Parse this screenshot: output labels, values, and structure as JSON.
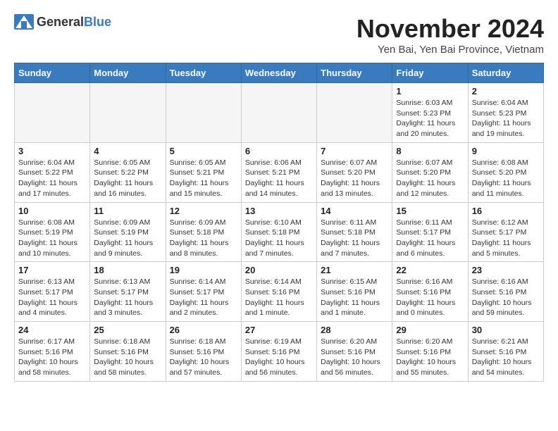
{
  "header": {
    "logo_general": "General",
    "logo_blue": "Blue",
    "month_title": "November 2024",
    "location": "Yen Bai, Yen Bai Province, Vietnam"
  },
  "weekdays": [
    "Sunday",
    "Monday",
    "Tuesday",
    "Wednesday",
    "Thursday",
    "Friday",
    "Saturday"
  ],
  "weeks": [
    [
      {
        "day": "",
        "info": ""
      },
      {
        "day": "",
        "info": ""
      },
      {
        "day": "",
        "info": ""
      },
      {
        "day": "",
        "info": ""
      },
      {
        "day": "",
        "info": ""
      },
      {
        "day": "1",
        "info": "Sunrise: 6:03 AM\nSunset: 5:23 PM\nDaylight: 11 hours and 20 minutes."
      },
      {
        "day": "2",
        "info": "Sunrise: 6:04 AM\nSunset: 5:23 PM\nDaylight: 11 hours and 19 minutes."
      }
    ],
    [
      {
        "day": "3",
        "info": "Sunrise: 6:04 AM\nSunset: 5:22 PM\nDaylight: 11 hours and 17 minutes."
      },
      {
        "day": "4",
        "info": "Sunrise: 6:05 AM\nSunset: 5:22 PM\nDaylight: 11 hours and 16 minutes."
      },
      {
        "day": "5",
        "info": "Sunrise: 6:05 AM\nSunset: 5:21 PM\nDaylight: 11 hours and 15 minutes."
      },
      {
        "day": "6",
        "info": "Sunrise: 6:06 AM\nSunset: 5:21 PM\nDaylight: 11 hours and 14 minutes."
      },
      {
        "day": "7",
        "info": "Sunrise: 6:07 AM\nSunset: 5:20 PM\nDaylight: 11 hours and 13 minutes."
      },
      {
        "day": "8",
        "info": "Sunrise: 6:07 AM\nSunset: 5:20 PM\nDaylight: 11 hours and 12 minutes."
      },
      {
        "day": "9",
        "info": "Sunrise: 6:08 AM\nSunset: 5:20 PM\nDaylight: 11 hours and 11 minutes."
      }
    ],
    [
      {
        "day": "10",
        "info": "Sunrise: 6:08 AM\nSunset: 5:19 PM\nDaylight: 11 hours and 10 minutes."
      },
      {
        "day": "11",
        "info": "Sunrise: 6:09 AM\nSunset: 5:19 PM\nDaylight: 11 hours and 9 minutes."
      },
      {
        "day": "12",
        "info": "Sunrise: 6:09 AM\nSunset: 5:18 PM\nDaylight: 11 hours and 8 minutes."
      },
      {
        "day": "13",
        "info": "Sunrise: 6:10 AM\nSunset: 5:18 PM\nDaylight: 11 hours and 7 minutes."
      },
      {
        "day": "14",
        "info": "Sunrise: 6:11 AM\nSunset: 5:18 PM\nDaylight: 11 hours and 7 minutes."
      },
      {
        "day": "15",
        "info": "Sunrise: 6:11 AM\nSunset: 5:17 PM\nDaylight: 11 hours and 6 minutes."
      },
      {
        "day": "16",
        "info": "Sunrise: 6:12 AM\nSunset: 5:17 PM\nDaylight: 11 hours and 5 minutes."
      }
    ],
    [
      {
        "day": "17",
        "info": "Sunrise: 6:13 AM\nSunset: 5:17 PM\nDaylight: 11 hours and 4 minutes."
      },
      {
        "day": "18",
        "info": "Sunrise: 6:13 AM\nSunset: 5:17 PM\nDaylight: 11 hours and 3 minutes."
      },
      {
        "day": "19",
        "info": "Sunrise: 6:14 AM\nSunset: 5:17 PM\nDaylight: 11 hours and 2 minutes."
      },
      {
        "day": "20",
        "info": "Sunrise: 6:14 AM\nSunset: 5:16 PM\nDaylight: 11 hours and 1 minute."
      },
      {
        "day": "21",
        "info": "Sunrise: 6:15 AM\nSunset: 5:16 PM\nDaylight: 11 hours and 1 minute."
      },
      {
        "day": "22",
        "info": "Sunrise: 6:16 AM\nSunset: 5:16 PM\nDaylight: 11 hours and 0 minutes."
      },
      {
        "day": "23",
        "info": "Sunrise: 6:16 AM\nSunset: 5:16 PM\nDaylight: 10 hours and 59 minutes."
      }
    ],
    [
      {
        "day": "24",
        "info": "Sunrise: 6:17 AM\nSunset: 5:16 PM\nDaylight: 10 hours and 58 minutes."
      },
      {
        "day": "25",
        "info": "Sunrise: 6:18 AM\nSunset: 5:16 PM\nDaylight: 10 hours and 58 minutes."
      },
      {
        "day": "26",
        "info": "Sunrise: 6:18 AM\nSunset: 5:16 PM\nDaylight: 10 hours and 57 minutes."
      },
      {
        "day": "27",
        "info": "Sunrise: 6:19 AM\nSunset: 5:16 PM\nDaylight: 10 hours and 56 minutes."
      },
      {
        "day": "28",
        "info": "Sunrise: 6:20 AM\nSunset: 5:16 PM\nDaylight: 10 hours and 56 minutes."
      },
      {
        "day": "29",
        "info": "Sunrise: 6:20 AM\nSunset: 5:16 PM\nDaylight: 10 hours and 55 minutes."
      },
      {
        "day": "30",
        "info": "Sunrise: 6:21 AM\nSunset: 5:16 PM\nDaylight: 10 hours and 54 minutes."
      }
    ]
  ]
}
